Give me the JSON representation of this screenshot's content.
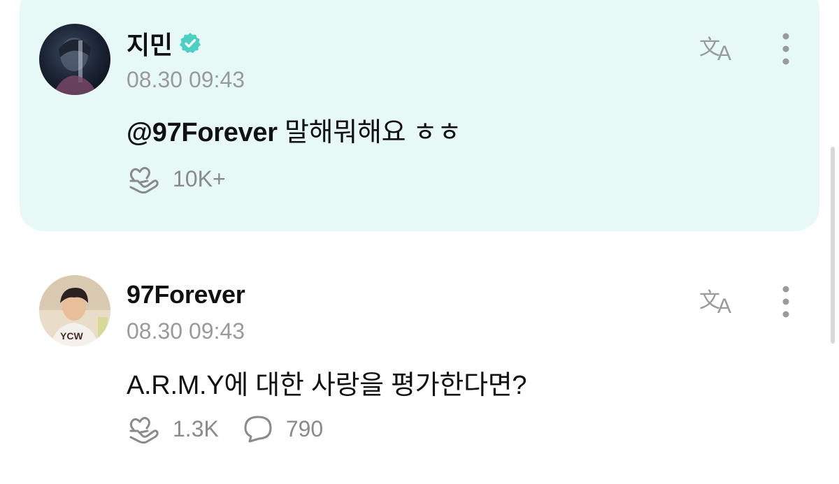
{
  "posts": [
    {
      "username": "지민",
      "verified": true,
      "timestamp": "08.30 09:43",
      "mention": "@97Forever",
      "text": " 말해뭐해요 ㅎㅎ",
      "likes": "10K+",
      "comments": null,
      "highlighted": true
    },
    {
      "username": "97Forever",
      "verified": false,
      "timestamp": "08.30 09:43",
      "mention": "",
      "text": "A.R.M.Y에 대한 사랑을 평가한다면?",
      "likes": "1.3K",
      "comments": "790",
      "highlighted": false
    }
  ],
  "colors": {
    "highlight_bg": "#e6f9f6",
    "icon_gray": "#8a8a8a",
    "verified_teal": "#4dd0c4"
  },
  "icons": {
    "translate": "translate-icon",
    "more": "more-vertical-icon",
    "like": "heart-hand-icon",
    "comment": "comment-bubble-icon",
    "verified": "verified-badge-icon"
  }
}
